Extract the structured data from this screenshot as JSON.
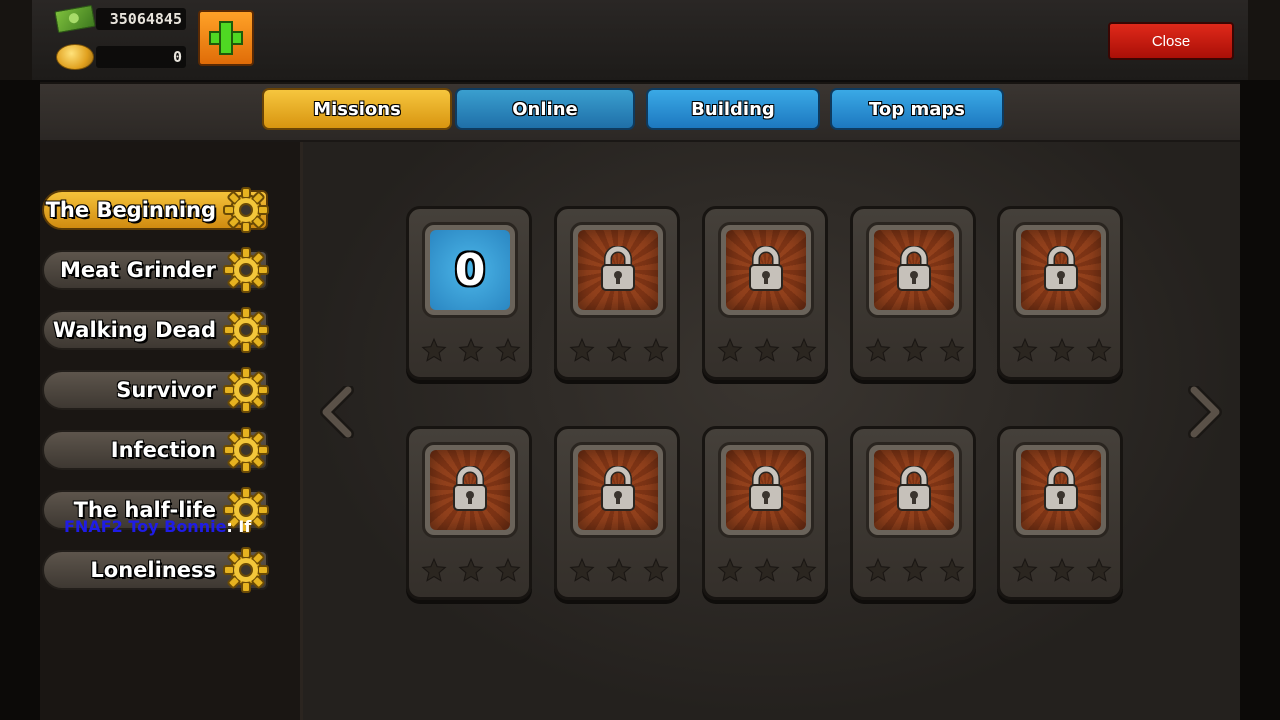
{
  "header": {
    "cash_value": "35064845",
    "gold_value": "0",
    "close_label": "Close"
  },
  "tabs": [
    {
      "label": "Missions",
      "active": true
    },
    {
      "label": "Online",
      "active": false
    },
    {
      "label": "Building",
      "active": false
    },
    {
      "label": "Top maps",
      "active": false
    }
  ],
  "missions": [
    {
      "label": "The Beginning",
      "active": true
    },
    {
      "label": "Meat Grinder",
      "active": false
    },
    {
      "label": "Walking Dead",
      "active": false
    },
    {
      "label": "Survivor",
      "active": false
    },
    {
      "label": "Infection",
      "active": false
    },
    {
      "label": "The half-life",
      "active": false
    },
    {
      "label": "Loneliness",
      "active": false
    }
  ],
  "chat": {
    "name": "FNAF2 Toy Bonnie",
    "message": ": If"
  },
  "levels": [
    {
      "number": "0",
      "locked": false,
      "stars": 0
    },
    {
      "locked": true,
      "stars": 0
    },
    {
      "locked": true,
      "stars": 0
    },
    {
      "locked": true,
      "stars": 0
    },
    {
      "locked": true,
      "stars": 0
    },
    {
      "locked": true,
      "stars": 0
    },
    {
      "locked": true,
      "stars": 0
    },
    {
      "locked": true,
      "stars": 0
    },
    {
      "locked": true,
      "stars": 0
    },
    {
      "locked": true,
      "stars": 0
    }
  ],
  "colors": {
    "active_gold": "#f5c23a",
    "tab_blue": "#2a8fd6",
    "close_red": "#c81c10",
    "plus_green": "#4fd823",
    "locked_tile": "#8a3b18",
    "unlocked_tile": "#3aa0d6"
  },
  "icons": {
    "cash": "cash-icon",
    "gold": "gold-coins-icon",
    "add": "plus-icon",
    "mission": "gear-icon",
    "locked_level": "lock-icon",
    "rating": "star-icon",
    "nav_prev": "chevron-left-icon",
    "nav_next": "chevron-right-icon"
  }
}
